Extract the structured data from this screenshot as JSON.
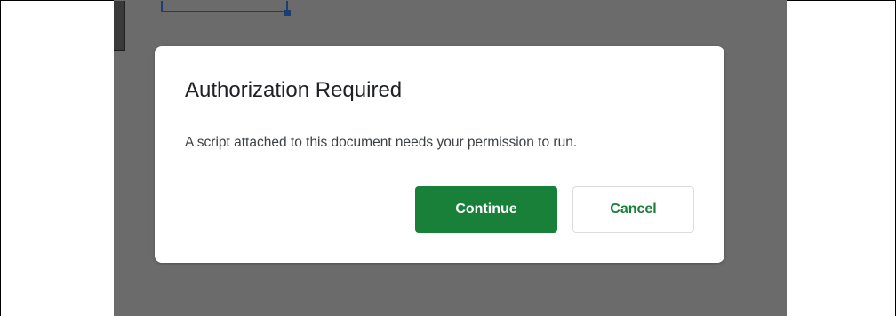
{
  "dialog": {
    "title": "Authorization Required",
    "message": "A script attached to this document needs your permission to run.",
    "continue_label": "Continue",
    "cancel_label": "Cancel"
  },
  "colors": {
    "overlay": "#6b6b6b",
    "primary": "#188038",
    "title_text": "#202124",
    "body_text": "#3c4043"
  }
}
